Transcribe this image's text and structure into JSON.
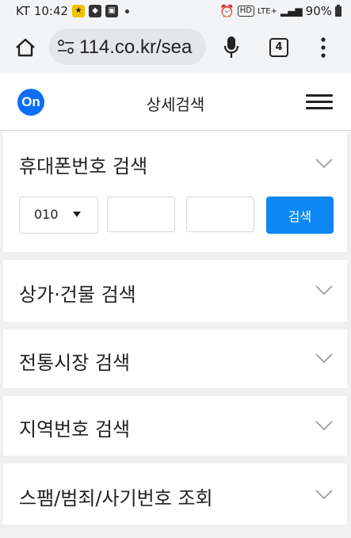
{
  "status_bar": {
    "carrier": "KT",
    "time": "10:42",
    "network": "LTE+",
    "battery": "90%",
    "icons": [
      "yellow-app-icon",
      "shield-app-icon",
      "image-icon",
      "alarm-icon",
      "hd-icon",
      "signal-icon",
      "battery-icon"
    ]
  },
  "browser": {
    "url": "114.co.kr/sea",
    "tab_count": "4",
    "icons": [
      "home-icon",
      "site-settings-icon",
      "mic-icon",
      "tabs-icon",
      "more-vert-icon"
    ]
  },
  "header": {
    "logo_text": "On",
    "title": "상세검색",
    "logo_color": "#0d6efd"
  },
  "sections": {
    "phone": {
      "title": "휴대폰번호 검색",
      "prefix_value": "010",
      "search_label": "검색",
      "button_color": "#0d87f5"
    },
    "building": {
      "title": "상가·건물 검색"
    },
    "market": {
      "title": "전통시장 검색"
    },
    "area_code": {
      "title": "지역번호 검색"
    },
    "spam": {
      "title": "스팸/범죄/사기번호 조회"
    }
  }
}
